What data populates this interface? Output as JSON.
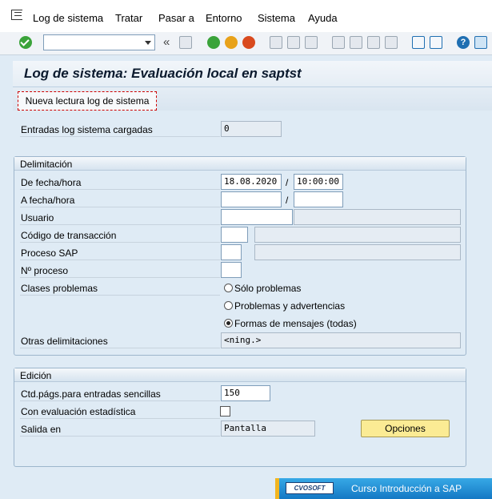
{
  "menu": {
    "items": [
      "Log de sistema",
      "Tratar",
      "Pasar a",
      "Entorno",
      "Sistema",
      "Ayuda"
    ]
  },
  "toolbar": {
    "command_value": "",
    "nav_glyph": "«",
    "icons": [
      "check-icon",
      "save-icon",
      "back-icon",
      "exit-icon",
      "cancel-icon",
      "print-icon",
      "find-icon",
      "find-next-icon",
      "first-page-icon",
      "prev-page-icon",
      "next-page-icon",
      "last-page-icon",
      "create-session-icon",
      "shortcut-icon",
      "help-icon",
      "layout-icon"
    ],
    "colors": {
      "back": "#3aa33a",
      "exit": "#e8a21a",
      "cancel": "#d94a1e",
      "help": "#1f6fb2"
    }
  },
  "page": {
    "title": "Log de sistema: Evaluación local en saptst",
    "reload_button": "Nueva lectura log de sistema",
    "loaded_label": "Entradas log sistema cargadas",
    "loaded_value": "0"
  },
  "delim": {
    "title": "Delimitación",
    "from_label": "De fecha/hora",
    "from_date": "18.08.2020",
    "from_time": "10:00:00",
    "slash": "/",
    "to_label": "A fecha/hora",
    "to_date": "",
    "to_time": "",
    "user_label": "Usuario",
    "user_value": "",
    "tcode_label": "Código de transacción",
    "tcode_value": "",
    "process_label": "Proceso SAP",
    "process_value": "",
    "procno_label": "Nº proceso",
    "procno_value": "",
    "classes_label": "Clases problemas",
    "radio_problems": "Sólo problemas",
    "radio_warnings": "Problemas y advertencias",
    "radio_all": "Formas de mensajes (todas)",
    "selected_class": "all",
    "other_label": "Otras delimitaciones",
    "other_value": "<ning.>"
  },
  "edition": {
    "title": "Edición",
    "pages_label": "Ctd.págs.para entradas sencillas",
    "pages_value": "150",
    "stats_label": "Con evaluación estadística",
    "stats_checked": false,
    "output_label": "Salida en",
    "output_value": "Pantalla",
    "options_button": "Opciones"
  },
  "banner": {
    "logo_text": "CVOSOFT",
    "text": "Curso Introducción a SAP"
  },
  "colors": {
    "background": "#dfebf5",
    "options_button": "#fbeb94",
    "banner": "#1478c4",
    "banner_accent": "#f2b51f"
  }
}
